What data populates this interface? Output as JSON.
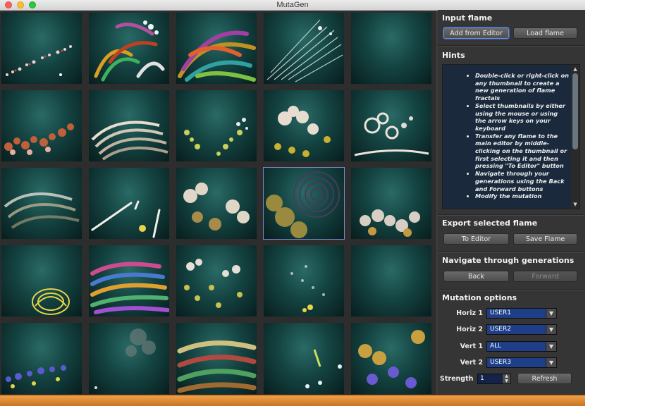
{
  "window": {
    "title": "MutaGen"
  },
  "input_flame": {
    "heading": "Input flame",
    "add_from_editor": "Add from Editor",
    "load_flame": "Load flame"
  },
  "hints": {
    "heading": "Hints",
    "items": [
      "Double-click or right-click on any thumbnail to create a new generation of flame fractals",
      "Select thumbnails by either using the mouse or using the arrow keys on your keyboard",
      "Transfer any flame to the main editor by middle-clicking on the thumbnail or first selecting it and then pressing \"To Editor\" button",
      "Navigate through your generations using the Back and Forward buttons",
      "Modify the mutation"
    ]
  },
  "export": {
    "heading": "Export selected flame",
    "to_editor": "To Editor",
    "save_flame": "Save Flame"
  },
  "navigate": {
    "heading": "Navigate through generations",
    "back": "Back",
    "forward": "Forward"
  },
  "mutation": {
    "heading": "Mutation options",
    "horiz1_label": "Horiz 1",
    "horiz1_value": "USER1",
    "horiz2_label": "Horiz 2",
    "horiz2_value": "USER2",
    "vert1_label": "Vert 1",
    "vert1_value": "ALL",
    "vert2_label": "Vert 2",
    "vert2_value": "USER3",
    "strength_label": "Strength",
    "strength_value": "1",
    "refresh": "Refresh"
  },
  "thumbnails": {
    "rows": 5,
    "cols": 5,
    "selected_index": 12
  }
}
